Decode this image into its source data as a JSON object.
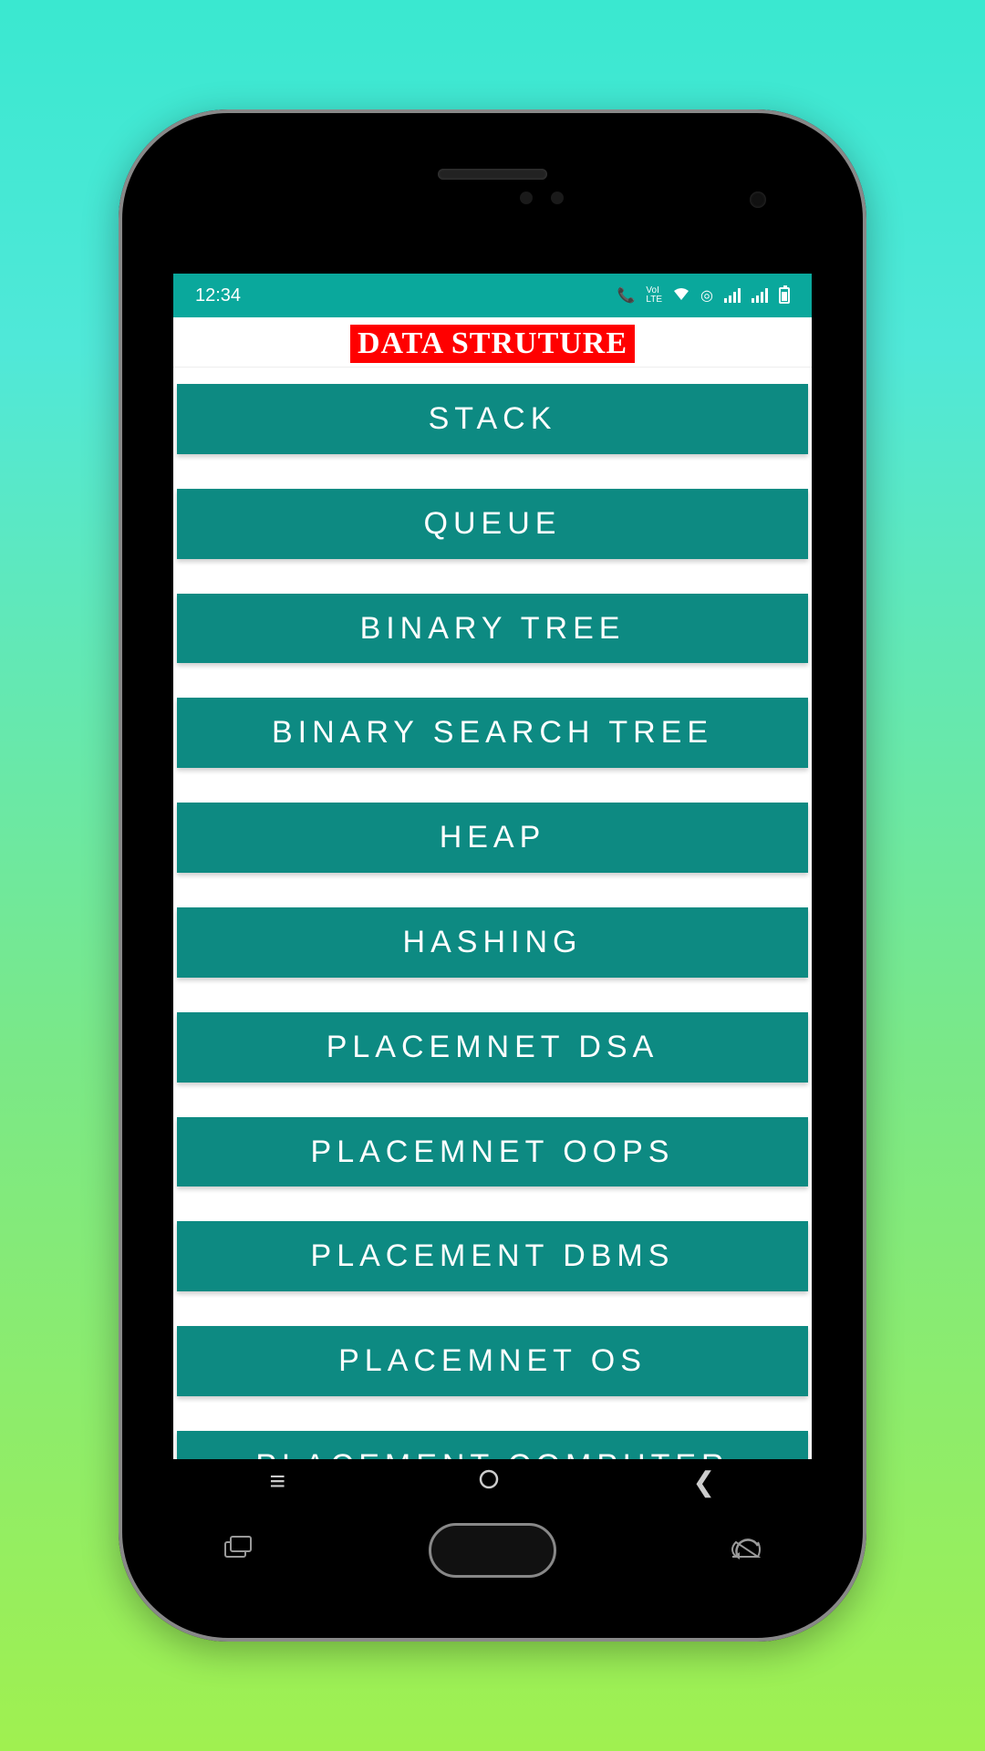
{
  "status": {
    "time": "12:34",
    "indicators": [
      "VoLTE",
      "wifi",
      "hotspot",
      "signal",
      "signal",
      "battery"
    ]
  },
  "header": {
    "title": "DATA STRUTURE"
  },
  "items": [
    "STACK",
    "QUEUE",
    "BINARY TREE",
    "BINARY SEARCH TREE",
    "HEAP",
    "HASHING",
    "PLACEMNET DSA",
    "PLACEMNET OOPS",
    "PLACEMENT DBMS",
    "PLACEMNET OS",
    "PLACEMENT COMPUTER NETWORK"
  ],
  "colors": {
    "accent": "#0d8a82",
    "statusbar": "#0aa89c",
    "titleBg": "#ff0000"
  }
}
